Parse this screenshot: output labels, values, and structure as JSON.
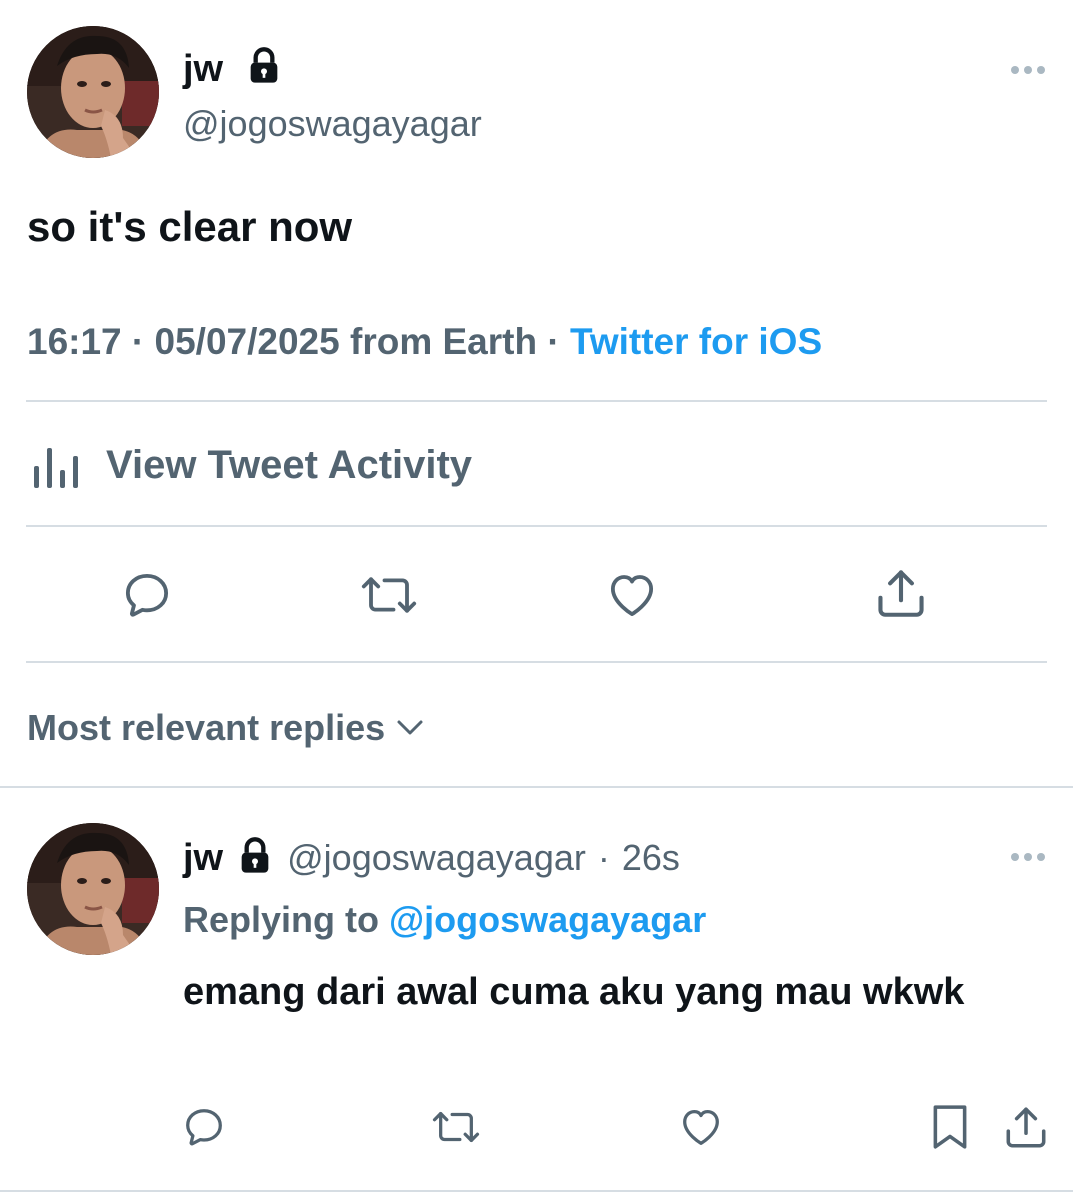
{
  "tweet": {
    "author_name": "jw",
    "author_handle": "@jogoswagayagar",
    "text": "so it's clear now",
    "time": "16:17",
    "date": "05/07/2025",
    "location": "from Earth",
    "separator": "·",
    "source": "Twitter for iOS",
    "activity_label": "View Tweet Activity"
  },
  "actions": {
    "reply_icon": "reply-icon",
    "retweet_icon": "retweet-icon",
    "like_icon": "heart-icon",
    "share_icon": "share-icon"
  },
  "replies_sort": {
    "label": "Most relevant replies"
  },
  "reply": {
    "author_name": "jw",
    "author_handle": "@jogoswagayagar",
    "separator": "·",
    "age": "26s",
    "replying_prefix": "Replying to",
    "replying_handle": "@jogoswagayagar",
    "text": "emang dari awal cuma aku yang mau wkwk"
  },
  "colors": {
    "text_primary": "#0f1419",
    "text_secondary": "#536471",
    "link": "#1d9bf0",
    "divider": "#d6dde3"
  }
}
